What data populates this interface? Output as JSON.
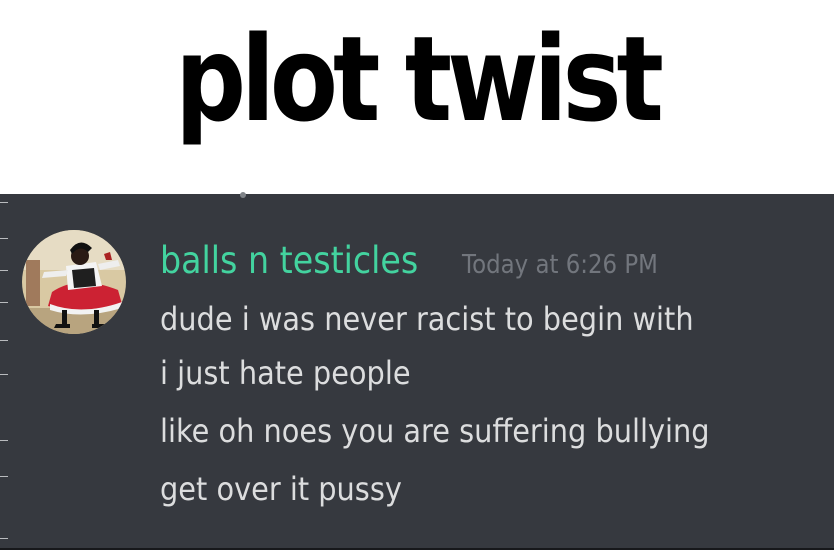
{
  "caption": {
    "text": "plot twist"
  },
  "chat": {
    "author": {
      "username": "balls n testicles",
      "username_color": "#43d39f",
      "avatar_icon": "avatar-dancer-icon"
    },
    "timestamp": "Today at 6:26 PM",
    "messages": [
      "dude i was never racist to begin with",
      "i just hate people",
      "like oh noes you are suffering bullying",
      "get over it pussy"
    ],
    "colors": {
      "background": "#36393f",
      "text": "#dcddde",
      "timestamp": "#72767d"
    }
  }
}
